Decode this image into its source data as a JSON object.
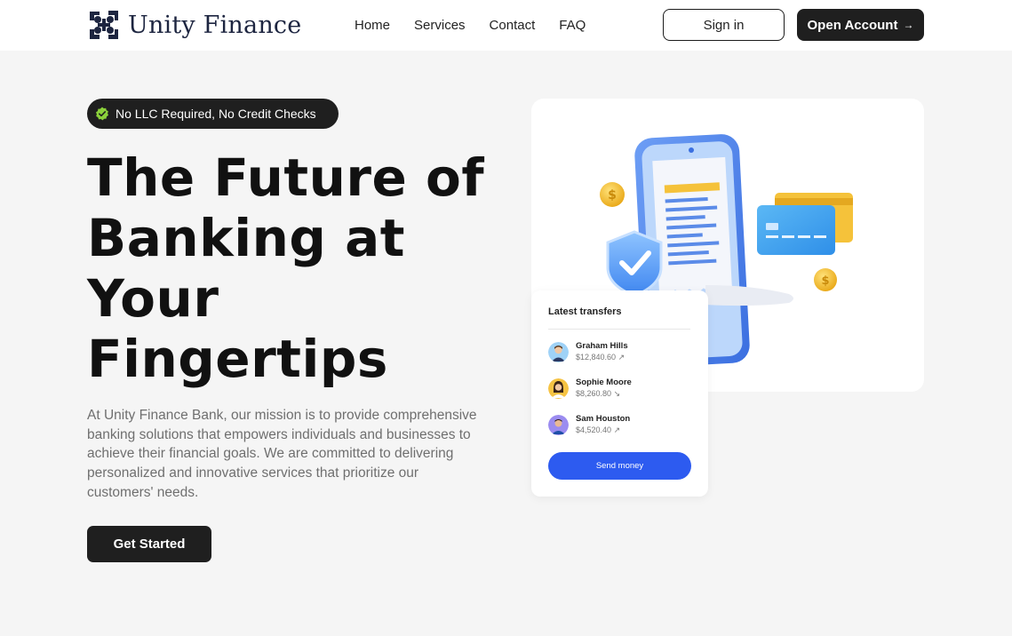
{
  "header": {
    "brand": "Unity Finance",
    "nav": [
      "Home",
      "Services",
      "Contact",
      "FAQ"
    ],
    "signin_label": "Sign in",
    "open_account_label": "Open Account",
    "open_account_arrow": "→"
  },
  "hero": {
    "badge": "No LLC Required, No Credit Checks",
    "title": "The Future of Banking at Your Fingertips",
    "description": "At Unity Finance Bank, our mission is to provide comprehensive banking solutions that empowers individuals and businesses to achieve their financial goals. We are committed to delivering personalized and innovative services that prioritize our customers' needs.",
    "cta": "Get Started"
  },
  "transfers": {
    "title": "Latest transfers",
    "items": [
      {
        "name": "Graham Hills",
        "amount": "$12,840.60",
        "dir": "↗"
      },
      {
        "name": "Sophie Moore",
        "amount": "$8,260.80",
        "dir": "↘"
      },
      {
        "name": "Sam Houston",
        "amount": "$4,520.40",
        "dir": "↗"
      }
    ],
    "send_label": "Send money"
  },
  "colors": {
    "dark": "#1f1f1f",
    "accent_blue": "#2d5bf0",
    "badge_check": "#8bd13b",
    "page_bg": "#f5f5f5"
  },
  "icons": [
    "logo-mark-icon",
    "check-badge-icon",
    "arrow-right-icon",
    "phone-receipt-illustration",
    "shield-check-icon",
    "coin-icon",
    "credit-card-icon"
  ]
}
